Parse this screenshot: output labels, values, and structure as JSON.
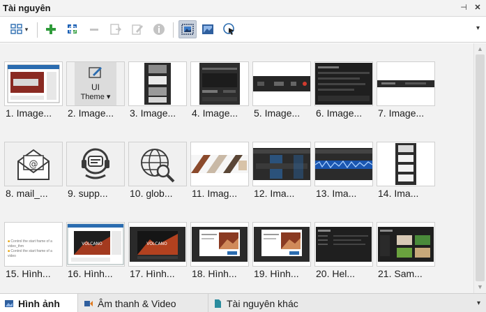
{
  "panel": {
    "title": "Tài nguyên",
    "pin_symbol": "⊣",
    "close_symbol": "✕",
    "dropdown_symbol": "▾"
  },
  "toolbar": {
    "tools": [
      {
        "name": "view-mode-icon",
        "state": "normal"
      },
      {
        "name": "add-icon",
        "state": "normal"
      },
      {
        "name": "grid-add-icon",
        "state": "normal"
      },
      {
        "name": "remove-icon",
        "state": "disabled"
      },
      {
        "name": "import-icon",
        "state": "disabled"
      },
      {
        "name": "edit-icon",
        "state": "disabled"
      },
      {
        "name": "info-icon",
        "state": "disabled"
      },
      {
        "name": "fit-image-icon",
        "state": "active"
      },
      {
        "name": "image-icon",
        "state": "normal"
      },
      {
        "name": "cursor-icon",
        "state": "normal"
      }
    ]
  },
  "resources": [
    {
      "caption": "1. Image...",
      "thumb": "screen-red"
    },
    {
      "caption": "2. Image...",
      "thumb": "ui-theme",
      "thumb_label": "UI",
      "thumb_sublabel": "Theme ▾"
    },
    {
      "caption": "3. Image...",
      "thumb": "vertical-panel"
    },
    {
      "caption": "4. Image...",
      "thumb": "dark-dialog"
    },
    {
      "caption": "5. Image...",
      "thumb": "dark-strip"
    },
    {
      "caption": "6. Image...",
      "thumb": "dark-list"
    },
    {
      "caption": "7. Image...",
      "thumb": "thin-strip"
    },
    {
      "caption": "8. mail_...",
      "thumb": "mail-icon"
    },
    {
      "caption": "9. supp...",
      "thumb": "support-icon"
    },
    {
      "caption": "10. glob...",
      "thumb": "globe-icon"
    },
    {
      "caption": "11. Imag...",
      "thumb": "photo-strip"
    },
    {
      "caption": "12. Ima...",
      "thumb": "timeline-blue"
    },
    {
      "caption": "13. Ima...",
      "thumb": "timeline-wave"
    },
    {
      "caption": "14. Ima...",
      "thumb": "vertical-buttons"
    },
    {
      "caption": "15. Hình...",
      "thumb": "text-doc",
      "thumb_lines": [
        "Control the start frame of a video_thm",
        "Control the start frame of a video"
      ]
    },
    {
      "caption": "16. Hình...",
      "thumb": "volcano-window",
      "thumb_label": "VOLCANO"
    },
    {
      "caption": "17. Hình...",
      "thumb": "volcano-dark",
      "thumb_label": "VOLCANO"
    },
    {
      "caption": "18. Hình...",
      "thumb": "dialog-photo"
    },
    {
      "caption": "19. Hình...",
      "thumb": "dialog-photo"
    },
    {
      "caption": "20. Hel...",
      "thumb": "dark-settings"
    },
    {
      "caption": "21. Sam...",
      "thumb": "dark-gallery"
    }
  ],
  "tabs": [
    {
      "label": "Hình ảnh",
      "active": true
    },
    {
      "label": "Âm thanh & Video",
      "active": false
    },
    {
      "label": "Tài nguyên khác",
      "active": false
    }
  ],
  "tab_overflow_symbol": "▾",
  "scroll": {
    "up": "▲",
    "down": "▼"
  },
  "colors": {
    "accent_green": "#2e9b3a",
    "accent_blue": "#1a5fb4",
    "active_tool_bg": "#c9d1dc"
  }
}
